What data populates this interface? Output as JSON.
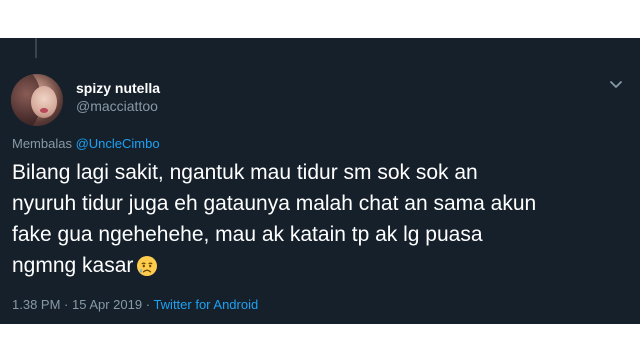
{
  "tweet": {
    "display_name": "spizy nutella",
    "handle": "@macciattoo",
    "replying_prefix": "Membalas ",
    "replying_to": "@UncleCimbo",
    "text": "Bilang lagi sakit, ngantuk mau tidur sm sok sok an\nnyuruh tidur juga eh gataunya malah chat an sama akun\nfake gua ngehehehe, mau ak katain tp ak lg puasa\nngmng kasar",
    "emoji": "crying-face-icon",
    "time": "1.38 PM",
    "separator": " · ",
    "date": "15 Apr 2019",
    "source": "Twitter for Android"
  },
  "colors": {
    "background": "#15202b",
    "text": "#ffffff",
    "secondary": "#8899a6",
    "accent": "#1da1f2"
  }
}
